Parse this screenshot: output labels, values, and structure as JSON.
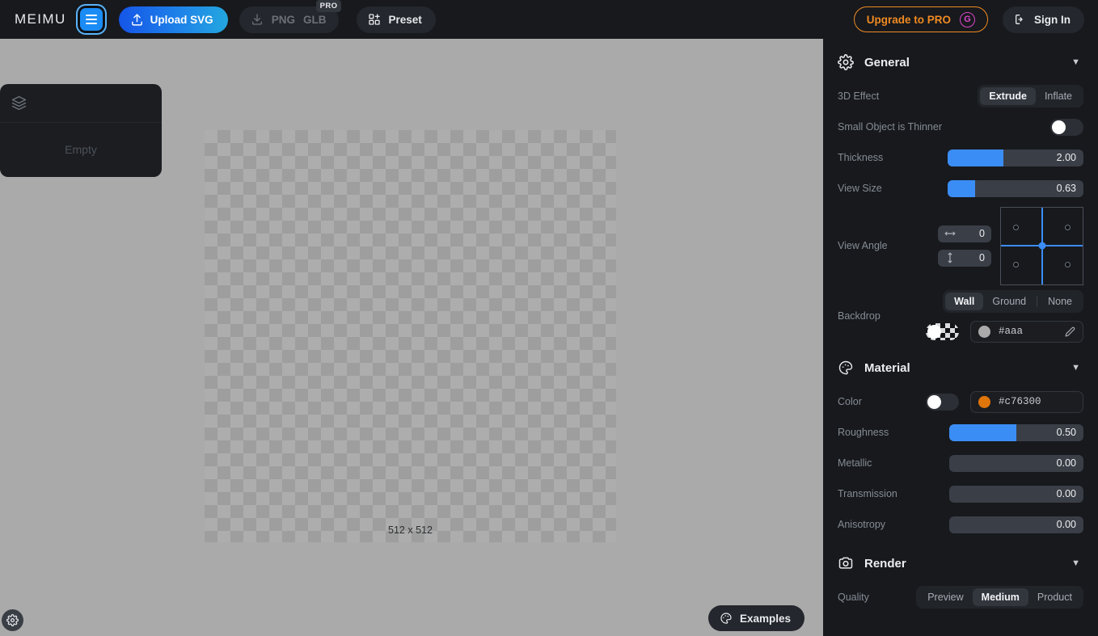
{
  "header": {
    "brand": "MEIMU",
    "menu_icon": "hamburger-icon",
    "upload": {
      "label": "Upload SVG",
      "icon": "upload-icon"
    },
    "export": {
      "png_label": "PNG",
      "glb_label": "GLB",
      "badge": "PRO",
      "icon": "download-icon",
      "disabled": true
    },
    "preset": {
      "label": "Preset",
      "icon": "grid-plus-icon"
    },
    "upgrade": {
      "label": "Upgrade to PRO",
      "icon": "g-circle-icon",
      "color": "#f08a22",
      "icon_color": "#d946c8"
    },
    "signin": {
      "label": "Sign In",
      "icon": "login-icon"
    }
  },
  "canvas": {
    "layers": {
      "icon": "layers-icon",
      "empty_label": "Empty"
    },
    "artboard_size": "512 x 512",
    "settings_fab": "gear-icon",
    "examples": {
      "label": "Examples",
      "icon": "palette-icon"
    }
  },
  "panel": {
    "general": {
      "title": "General",
      "icon": "gear-icon",
      "collapse_icon": "chevron-down-icon",
      "effect": {
        "label": "3D Effect",
        "options": [
          "Extrude",
          "Inflate"
        ],
        "selected": "Extrude"
      },
      "thinner": {
        "label": "Small Object is Thinner",
        "value": false
      },
      "thickness": {
        "label": "Thickness",
        "value": "2.00",
        "percent": 41
      },
      "view_size": {
        "label": "View Size",
        "value": "0.63",
        "percent": 20
      },
      "view_angle": {
        "label": "View Angle",
        "horizontal": {
          "icon": "arrows-horizontal-icon",
          "value": "0"
        },
        "vertical": {
          "icon": "arrows-vertical-icon",
          "value": "0"
        }
      },
      "backdrop": {
        "label": "Backdrop",
        "options": [
          "Wall",
          "Ground",
          "None"
        ],
        "selected": "Wall",
        "transparency_toggle": false,
        "color": "#aaa",
        "swatch_color": "#aaaaaa",
        "edit_icon": "pencil-icon"
      }
    },
    "material": {
      "title": "Material",
      "icon": "palette-icon",
      "collapse_icon": "chevron-down-icon",
      "color": {
        "label": "Color",
        "toggle": false,
        "hex": "#c76300",
        "swatch_color": "#e0750a"
      },
      "roughness": {
        "label": "Roughness",
        "value": "0.50",
        "percent": 50
      },
      "metallic": {
        "label": "Metallic",
        "value": "0.00",
        "percent": 0
      },
      "transmission": {
        "label": "Transmission",
        "value": "0.00",
        "percent": 0
      },
      "anisotropy": {
        "label": "Anisotropy",
        "value": "0.00",
        "percent": 0
      }
    },
    "render": {
      "title": "Render",
      "icon": "camera-icon",
      "collapse_icon": "chevron-down-icon",
      "quality": {
        "label": "Quality",
        "options": [
          "Preview",
          "Medium",
          "Product"
        ],
        "selected": "Medium"
      }
    }
  }
}
